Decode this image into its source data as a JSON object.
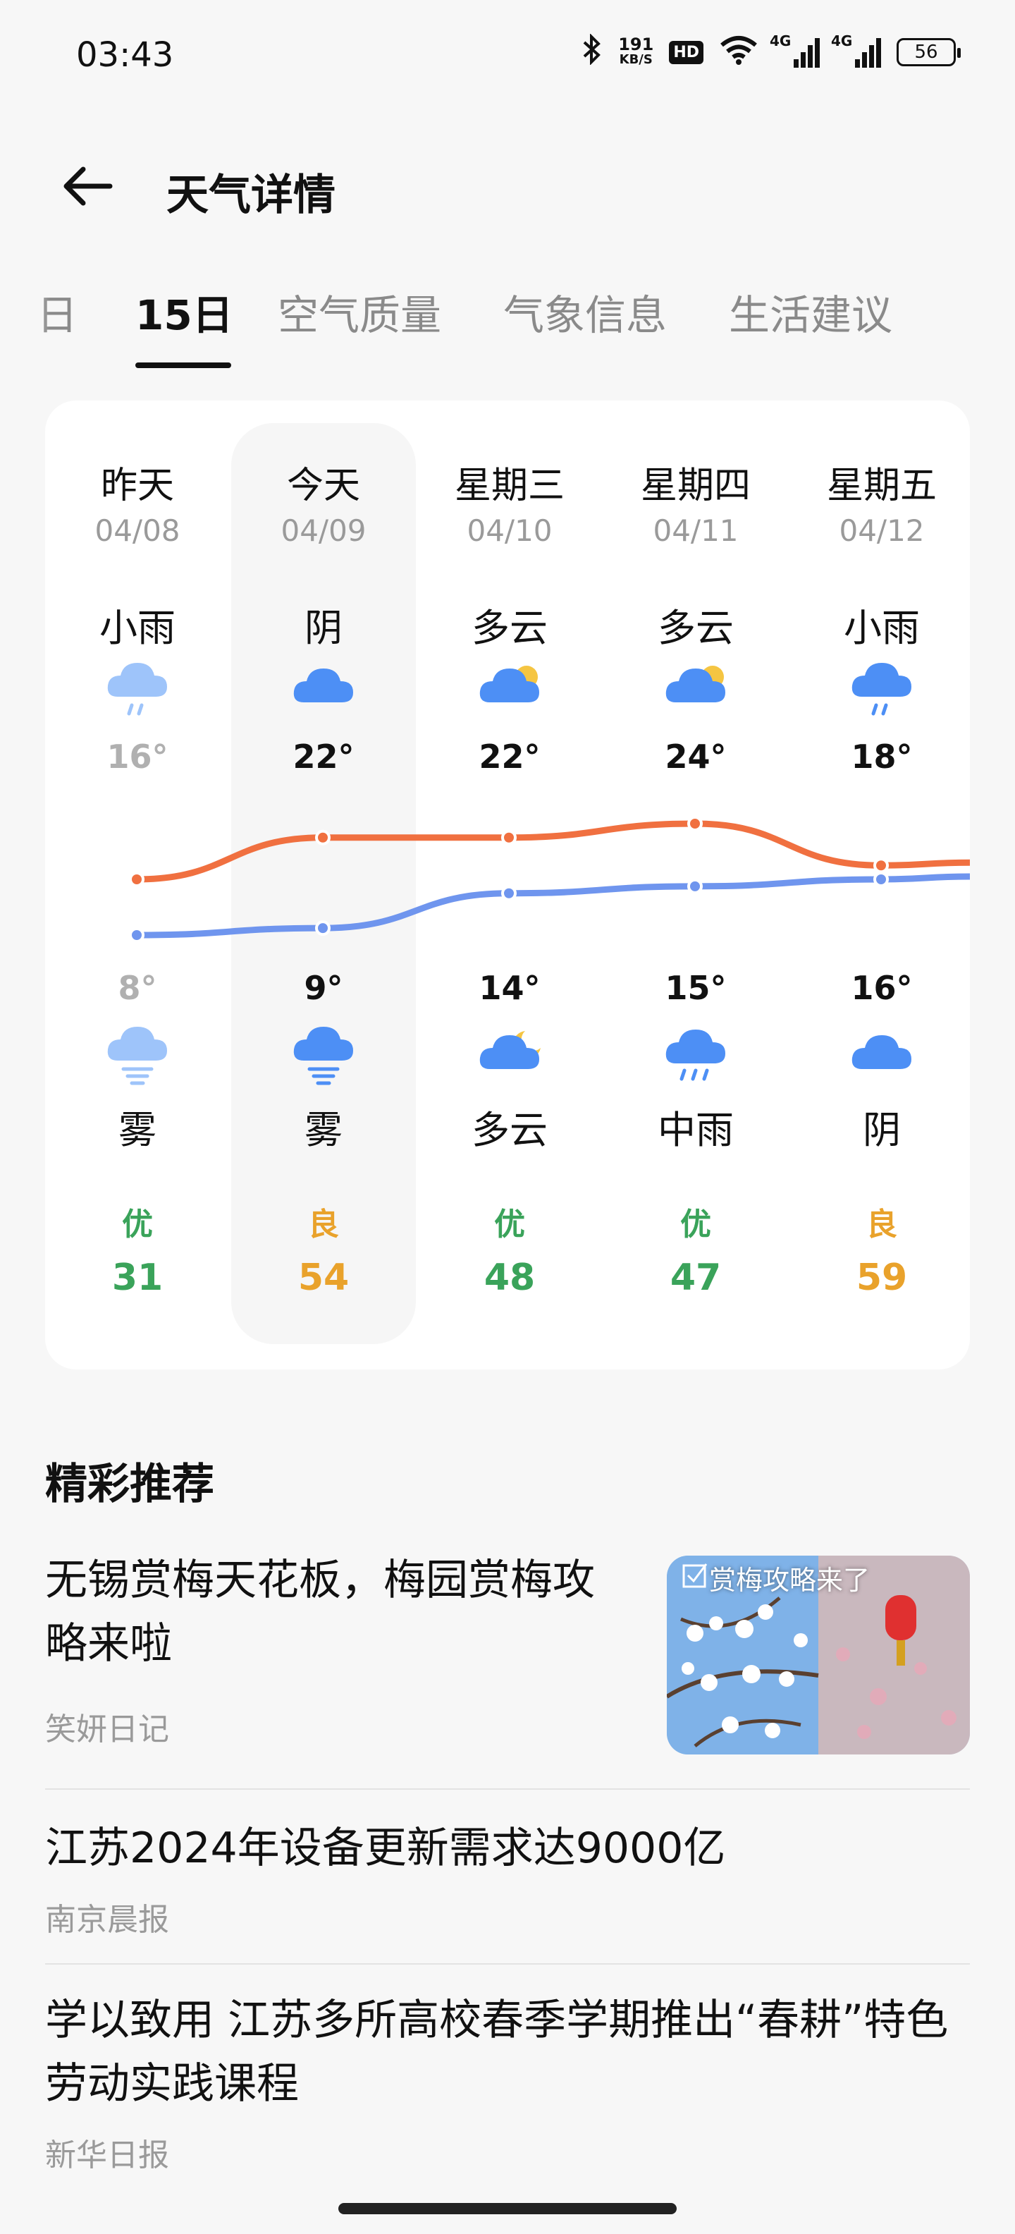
{
  "status_bar": {
    "time": "03:43",
    "speed_value": "191",
    "speed_unit": "KB/S",
    "hd_label": "HD",
    "signal1_label": "4G",
    "signal2_label": "4G",
    "battery": "56"
  },
  "header": {
    "title": "天气详情"
  },
  "tabs": [
    {
      "label": "日"
    },
    {
      "label": "15日",
      "active": true
    },
    {
      "label": "空气质量"
    },
    {
      "label": "气象信息"
    },
    {
      "label": "生活建议"
    }
  ],
  "days": [
    {
      "name": "昨天",
      "date": "04/08",
      "day_cond": "小雨",
      "day_icon": "light-rain-icon",
      "high": "16°",
      "low": "8°",
      "night_icon": "fog-icon",
      "night_cond": "雾",
      "aqi_label": "优",
      "aqi": "31",
      "aqi_color": "#3aa35a",
      "past": true
    },
    {
      "name": "今天",
      "date": "04/09",
      "day_cond": "阴",
      "day_icon": "overcast-icon",
      "high": "22°",
      "low": "9°",
      "night_icon": "fog-icon",
      "night_cond": "雾",
      "aqi_label": "良",
      "aqi": "54",
      "aqi_color": "#e9a22b",
      "past": false
    },
    {
      "name": "星期三",
      "date": "04/10",
      "day_cond": "多云",
      "day_icon": "partly-cloudy-day-icon",
      "high": "22°",
      "low": "14°",
      "night_icon": "partly-cloudy-night-icon",
      "night_cond": "多云",
      "aqi_label": "优",
      "aqi": "48",
      "aqi_color": "#3aa35a",
      "past": false
    },
    {
      "name": "星期四",
      "date": "04/11",
      "day_cond": "多云",
      "day_icon": "partly-cloudy-day-icon",
      "high": "24°",
      "low": "15°",
      "night_icon": "moderate-rain-icon",
      "night_cond": "中雨",
      "aqi_label": "优",
      "aqi": "47",
      "aqi_color": "#3aa35a",
      "past": false
    },
    {
      "name": "星期五",
      "date": "04/12",
      "day_cond": "小雨",
      "day_icon": "light-rain-icon",
      "high": "18°",
      "low": "16°",
      "night_icon": "overcast-icon",
      "night_cond": "阴",
      "aqi_label": "良",
      "aqi": "59",
      "aqi_color": "#e9a22b",
      "past": false
    }
  ],
  "colors": {
    "high_line": "#f07040",
    "low_line": "#6f95ee",
    "icon_blue": "#4d8ff5",
    "icon_blue_past": "#9ec4fa",
    "sun": "#f5c542"
  },
  "section_title": "精彩推荐",
  "news": [
    {
      "title": "无锡赏梅天花板，梅园赏梅攻略来啦",
      "source": "笑妍日记",
      "thumb_caption": "赏梅攻略来了"
    },
    {
      "title": "江苏2024年设备更新需求达9000亿",
      "source": "南京晨报"
    },
    {
      "title": "学以致用 江苏多所高校春季学期推出“春耕”特色劳动实践课程",
      "source": "新华日报"
    }
  ]
}
